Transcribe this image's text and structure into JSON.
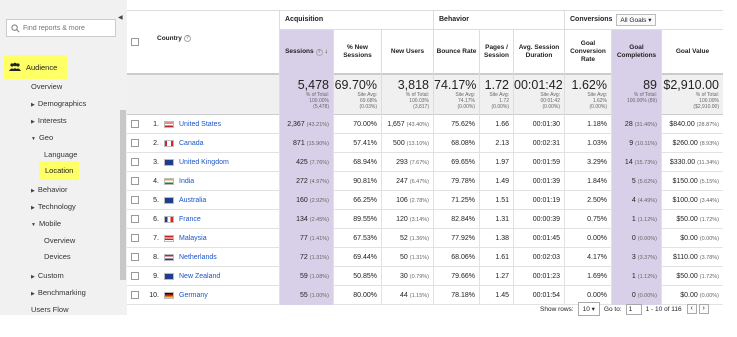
{
  "sidebar": {
    "search_placeholder": "Find reports & more",
    "audience_label": "Audience",
    "items": {
      "overview": "Overview",
      "demographics": "Demographics",
      "interests": "Interests",
      "geo": "Geo",
      "language": "Language",
      "location": "Location",
      "behavior": "Behavior",
      "technology": "Technology",
      "mobile": "Mobile",
      "mobile_overview": "Overview",
      "devices": "Devices",
      "custom": "Custom",
      "benchmarking": "Benchmarking",
      "users_flow": "Users Flow"
    }
  },
  "table": {
    "groups": {
      "acquisition": "Acquisition",
      "behavior": "Behavior",
      "conversions": "Conversions",
      "goals_select": "All Goals"
    },
    "headers": {
      "country": "Country",
      "sessions": "Sessions",
      "new_sessions": "% New Sessions",
      "new_users": "New Users",
      "bounce_rate": "Bounce Rate",
      "pages_session": "Pages / Session",
      "avg_duration": "Avg. Session Duration",
      "goal_conv": "Goal Conversion Rate",
      "goal_comp": "Goal Completions",
      "goal_value": "Goal Value"
    },
    "totals": {
      "sessions": {
        "big": "5,478",
        "l1": "% of Total:",
        "l2": "100.00%",
        "l3": "(5,478)"
      },
      "new_sessions": {
        "big": "69.70%",
        "l1": "Site Avg:",
        "l2": "69.68%",
        "l3": "(0.03%)"
      },
      "new_users": {
        "big": "3,818",
        "l1": "% of Total:",
        "l2": "100.03%",
        "l3": "(3,817)"
      },
      "bounce_rate": {
        "big": "74.17%",
        "l1": "Site Avg:",
        "l2": "74.17%",
        "l3": "(0.00%)"
      },
      "pages_session": {
        "big": "1.72",
        "l1": "Site Avg:",
        "l2": "1.72",
        "l3": "(0.00%)"
      },
      "avg_duration": {
        "big": "00:01:42",
        "l1": "Site Avg:",
        "l2": "00:01:42",
        "l3": "(0.00%)"
      },
      "goal_conv": {
        "big": "1.62%",
        "l1": "Site Avg:",
        "l2": "1.62%",
        "l3": "(0.00%)"
      },
      "goal_comp": {
        "big": "89",
        "l1": "% of Total:",
        "l2": "100.00% (89)",
        "l3": ""
      },
      "goal_value": {
        "big": "$2,910.00",
        "l1": "% of Total:",
        "l2": "100.00%",
        "l3": "($2,910.00)"
      }
    },
    "rows": [
      {
        "idx": "1.",
        "country": "United States",
        "sessions": "2,367",
        "sessions_pct": "(43.21%)",
        "new_sessions": "70.00%",
        "new_users": "1,657",
        "new_users_pct": "(43.40%)",
        "bounce": "75.62%",
        "pages": "1.66",
        "dur": "00:01:30",
        "conv": "1.18%",
        "comp": "28",
        "comp_pct": "(31.46%)",
        "value": "$840.00",
        "value_pct": "(28.87%)"
      },
      {
        "idx": "2.",
        "country": "Canada",
        "sessions": "871",
        "sessions_pct": "(15.90%)",
        "new_sessions": "57.41%",
        "new_users": "500",
        "new_users_pct": "(13.10%)",
        "bounce": "68.08%",
        "pages": "2.13",
        "dur": "00:02:31",
        "conv": "1.03%",
        "comp": "9",
        "comp_pct": "(10.11%)",
        "value": "$260.00",
        "value_pct": "(8.93%)"
      },
      {
        "idx": "3.",
        "country": "United Kingdom",
        "sessions": "425",
        "sessions_pct": "(7.76%)",
        "new_sessions": "68.94%",
        "new_users": "293",
        "new_users_pct": "(7.67%)",
        "bounce": "69.65%",
        "pages": "1.97",
        "dur": "00:01:59",
        "conv": "3.29%",
        "comp": "14",
        "comp_pct": "(15.73%)",
        "value": "$330.00",
        "value_pct": "(11.34%)"
      },
      {
        "idx": "4.",
        "country": "India",
        "sessions": "272",
        "sessions_pct": "(4.97%)",
        "new_sessions": "90.81%",
        "new_users": "247",
        "new_users_pct": "(6.47%)",
        "bounce": "79.78%",
        "pages": "1.49",
        "dur": "00:01:39",
        "conv": "1.84%",
        "comp": "5",
        "comp_pct": "(5.62%)",
        "value": "$150.00",
        "value_pct": "(5.15%)"
      },
      {
        "idx": "5.",
        "country": "Australia",
        "sessions": "160",
        "sessions_pct": "(2.92%)",
        "new_sessions": "66.25%",
        "new_users": "106",
        "new_users_pct": "(2.78%)",
        "bounce": "71.25%",
        "pages": "1.51",
        "dur": "00:01:19",
        "conv": "2.50%",
        "comp": "4",
        "comp_pct": "(4.49%)",
        "value": "$100.00",
        "value_pct": "(3.44%)"
      },
      {
        "idx": "6.",
        "country": "France",
        "sessions": "134",
        "sessions_pct": "(2.45%)",
        "new_sessions": "89.55%",
        "new_users": "120",
        "new_users_pct": "(3.14%)",
        "bounce": "82.84%",
        "pages": "1.31",
        "dur": "00:00:39",
        "conv": "0.75%",
        "comp": "1",
        "comp_pct": "(1.12%)",
        "value": "$50.00",
        "value_pct": "(1.72%)"
      },
      {
        "idx": "7.",
        "country": "Malaysia",
        "sessions": "77",
        "sessions_pct": "(1.41%)",
        "new_sessions": "67.53%",
        "new_users": "52",
        "new_users_pct": "(1.36%)",
        "bounce": "77.92%",
        "pages": "1.38",
        "dur": "00:01:45",
        "conv": "0.00%",
        "comp": "0",
        "comp_pct": "(0.00%)",
        "value": "$0.00",
        "value_pct": "(0.00%)"
      },
      {
        "idx": "8.",
        "country": "Netherlands",
        "sessions": "72",
        "sessions_pct": "(1.31%)",
        "new_sessions": "69.44%",
        "new_users": "50",
        "new_users_pct": "(1.31%)",
        "bounce": "68.06%",
        "pages": "1.61",
        "dur": "00:02:03",
        "conv": "4.17%",
        "comp": "3",
        "comp_pct": "(3.37%)",
        "value": "$110.00",
        "value_pct": "(3.78%)"
      },
      {
        "idx": "9.",
        "country": "New Zealand",
        "sessions": "59",
        "sessions_pct": "(1.08%)",
        "new_sessions": "50.85%",
        "new_users": "30",
        "new_users_pct": "(0.79%)",
        "bounce": "79.66%",
        "pages": "1.27",
        "dur": "00:01:23",
        "conv": "1.69%",
        "comp": "1",
        "comp_pct": "(1.12%)",
        "value": "$50.00",
        "value_pct": "(1.72%)"
      },
      {
        "idx": "10.",
        "country": "Germany",
        "sessions": "55",
        "sessions_pct": "(1.00%)",
        "new_sessions": "80.00%",
        "new_users": "44",
        "new_users_pct": "(1.15%)",
        "bounce": "78.18%",
        "pages": "1.45",
        "dur": "00:01:54",
        "conv": "0.00%",
        "comp": "0",
        "comp_pct": "(0.00%)",
        "value": "$0.00",
        "value_pct": "(0.00%)"
      }
    ],
    "flags": [
      "us-flag-icon",
      "canada-flag-icon",
      "uk-flag-icon",
      "india-flag-icon",
      "australia-flag-icon",
      "france-flag-icon",
      "malaysia-flag-icon",
      "netherlands-flag-icon",
      "new-zealand-flag-icon",
      "germany-flag-icon"
    ]
  },
  "footer": {
    "show_rows_label": "Show rows:",
    "show_rows_value": "10",
    "goto_label": "Go to:",
    "goto_value": "1",
    "range": "1 - 10 of 116"
  },
  "colors": {
    "highlight": "#ffff66",
    "selected_col": "#d8d0e8",
    "link": "#1a55c8"
  }
}
